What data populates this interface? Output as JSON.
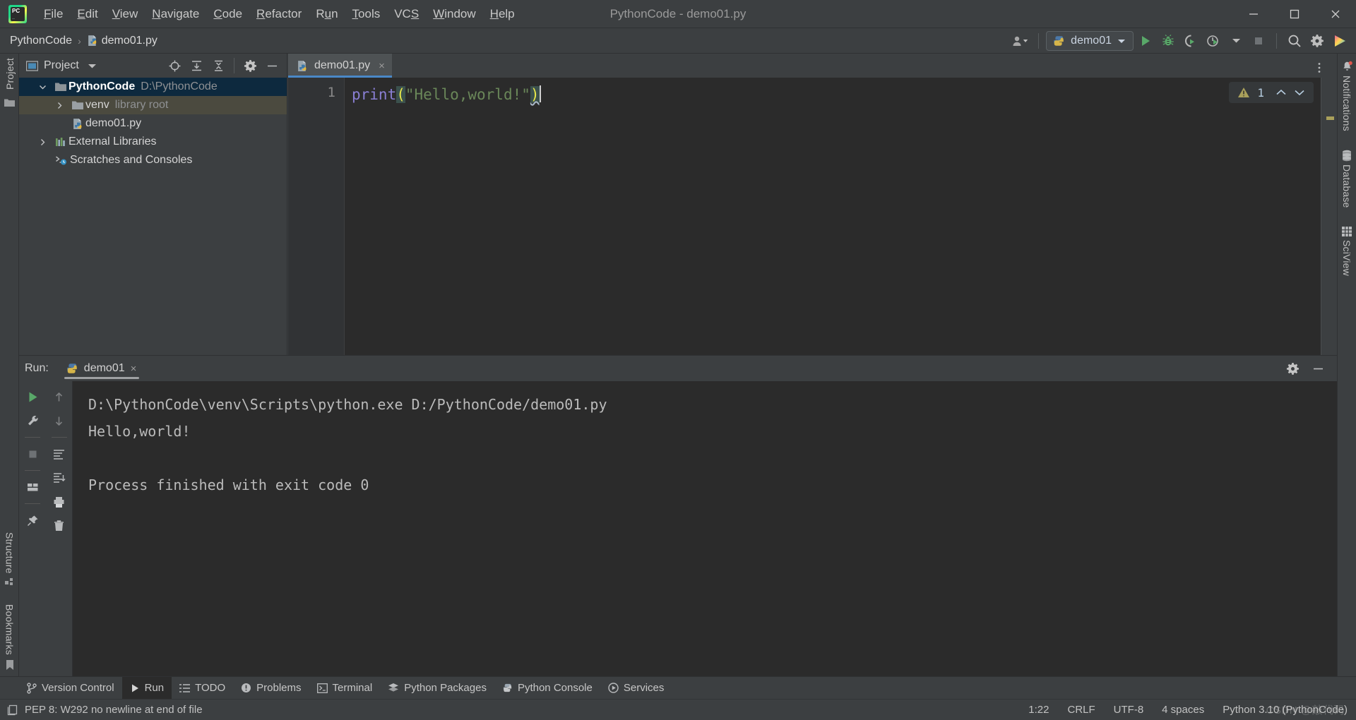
{
  "window": {
    "title": "PythonCode - demo01.py",
    "controls": {
      "minimize": "minimize-icon",
      "maximize": "maximize-icon",
      "close": "close-icon"
    }
  },
  "menu": {
    "items": [
      {
        "label": "File",
        "mnemonic": "F"
      },
      {
        "label": "Edit",
        "mnemonic": "E"
      },
      {
        "label": "View",
        "mnemonic": "V"
      },
      {
        "label": "Navigate",
        "mnemonic": "N"
      },
      {
        "label": "Code",
        "mnemonic": "C"
      },
      {
        "label": "Refactor",
        "mnemonic": "R"
      },
      {
        "label": "Run",
        "mnemonic": "u"
      },
      {
        "label": "Tools",
        "mnemonic": "T"
      },
      {
        "label": "VCS",
        "mnemonic": "S"
      },
      {
        "label": "Window",
        "mnemonic": "W"
      },
      {
        "label": "Help",
        "mnemonic": "H"
      }
    ]
  },
  "navbar": {
    "breadcrumb": {
      "project": "PythonCode",
      "separator": "›",
      "file": "demo01.py"
    },
    "run_config": "demo01",
    "icons": [
      "user-account-icon",
      "run-icon",
      "debug-icon",
      "run-coverage-icon",
      "profile-icon",
      "dropdown-icon",
      "stop-icon",
      "search-icon",
      "settings-gear-icon",
      "ai-assistant-icon"
    ]
  },
  "project_pane": {
    "title": "Project",
    "toolbar_icons": [
      "select-opened-file-icon",
      "expand-all-icon",
      "collapse-all-icon",
      "settings-gear-icon",
      "hide-icon"
    ],
    "tree": [
      {
        "label": "PythonCode",
        "sub": "D:\\PythonCode",
        "icon": "folder-icon",
        "arrow": "chevron-down-icon",
        "depth": 0,
        "state": "selected"
      },
      {
        "label": "venv",
        "sub": "library root",
        "icon": "folder-icon",
        "arrow": "chevron-right-icon",
        "depth": 1,
        "state": "hovered"
      },
      {
        "label": "demo01.py",
        "sub": "",
        "icon": "python-file-icon",
        "arrow": "",
        "depth": 1,
        "state": "normal"
      },
      {
        "label": "External Libraries",
        "sub": "",
        "icon": "libraries-icon",
        "arrow": "chevron-right-icon",
        "depth": 0,
        "state": "normal"
      },
      {
        "label": "Scratches and Consoles",
        "sub": "",
        "icon": "scratches-icon",
        "arrow": "",
        "depth": 0,
        "state": "normal"
      }
    ]
  },
  "editor": {
    "tab": {
      "label": "demo01.py",
      "icon": "python-file-icon",
      "close": "×"
    },
    "line_number": "1",
    "code": {
      "fn": "print",
      "open_paren": "(",
      "string": "\"Hello,world!\"",
      "close_paren": ")"
    },
    "inspection": {
      "count": "1",
      "icon": "warning-triangle-icon",
      "prev": "∧",
      "next": "∨"
    }
  },
  "left_stripe": {
    "top": [
      {
        "label": "Project",
        "icon": "project-icon"
      },
      {
        "label": "",
        "icon": "folder-icon"
      }
    ],
    "bottom": [
      {
        "label": "Structure",
        "icon": "structure-icon"
      },
      {
        "label": "Bookmarks",
        "icon": "bookmark-icon"
      }
    ]
  },
  "right_stripe": [
    {
      "label": "Notifications",
      "icon": "bell-icon",
      "badge": true
    },
    {
      "label": "Database",
      "icon": "database-icon",
      "badge": false
    },
    {
      "label": "SciView",
      "icon": "sciview-grid-icon",
      "badge": false
    }
  ],
  "run_window": {
    "label": "Run:",
    "tab": {
      "label": "demo01",
      "icon": "python-file-icon",
      "close": "×"
    },
    "header_icons": [
      "settings-gear-icon",
      "hide-icon"
    ],
    "left_toolbar": [
      "rerun-icon",
      "wrench-icon",
      "stop-icon",
      "layout-icon",
      "pin-icon"
    ],
    "second_toolbar": [
      "scroll-up-icon",
      "scroll-down-icon",
      "soft-wrap-icon",
      "scroll-to-end-icon",
      "print-icon",
      "clear-all-icon"
    ],
    "console": [
      "D:\\PythonCode\\venv\\Scripts\\python.exe D:/PythonCode/demo01.py",
      "Hello,world!",
      "",
      "Process finished with exit code 0"
    ]
  },
  "bottom_bar": {
    "items": [
      {
        "label": "Version Control",
        "icon": "branch-icon",
        "active": false
      },
      {
        "label": "Run",
        "icon": "run-icon",
        "active": true
      },
      {
        "label": "TODO",
        "icon": "todo-list-icon",
        "active": false
      },
      {
        "label": "Problems",
        "icon": "problems-icon",
        "active": false
      },
      {
        "label": "Terminal",
        "icon": "terminal-icon",
        "active": false
      },
      {
        "label": "Python Packages",
        "icon": "packages-icon",
        "active": false
      },
      {
        "label": "Python Console",
        "icon": "python-console-icon",
        "active": false
      },
      {
        "label": "Services",
        "icon": "services-icon",
        "active": false
      }
    ]
  },
  "status_bar": {
    "message": "PEP 8: W292 no newline at end of file",
    "message_icon": "document-icon",
    "caret": "1:22",
    "line_separator": "CRLF",
    "encoding": "UTF-8",
    "indent": "4 spaces",
    "interpreter": "Python 3.10 (PythonCode)",
    "watermark": "CSDN @敲代码"
  },
  "colors": {
    "accent_blue": "#4a88c7",
    "selection_blue": "#0d293e",
    "green_run": "#59a869",
    "string_green": "#6a8759",
    "keyword_purple": "#8a7fd4",
    "brace_yellow": "#e8e84a",
    "panel_bg": "#3c3f41",
    "editor_bg": "#2b2b2b"
  }
}
